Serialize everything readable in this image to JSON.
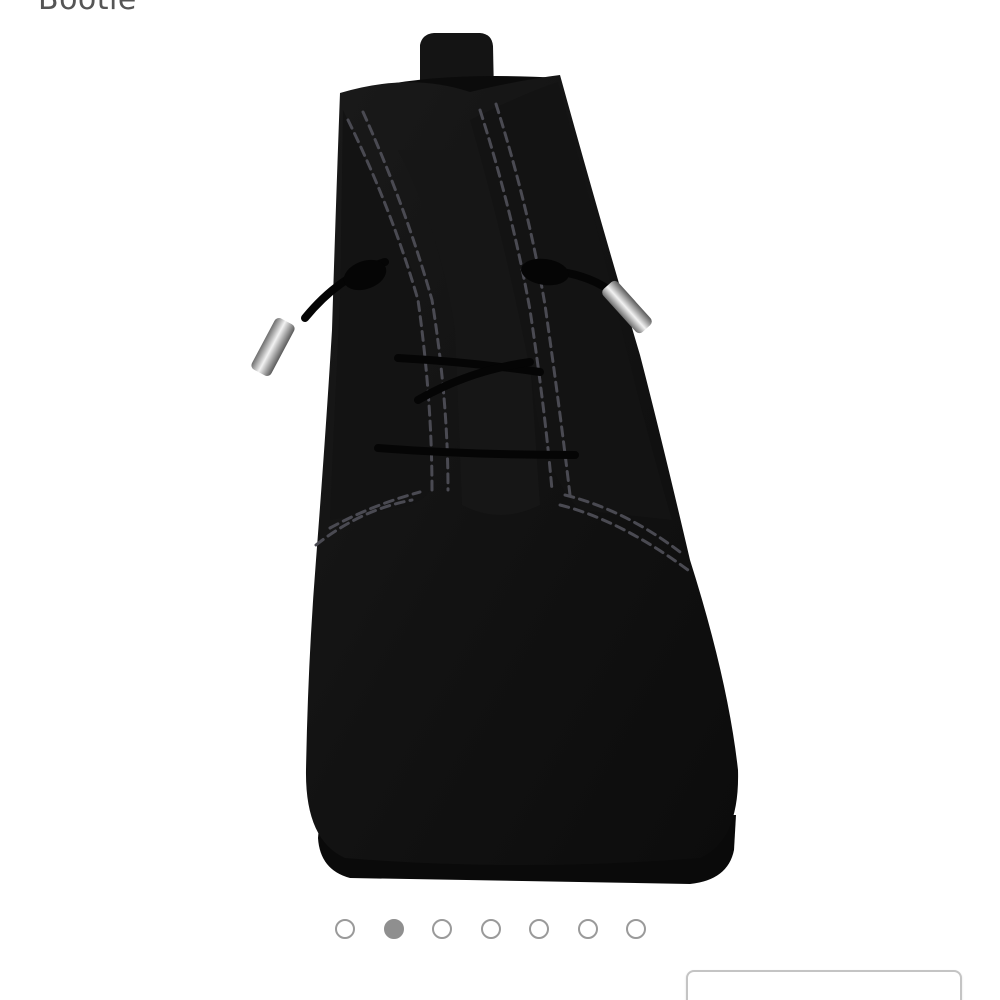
{
  "product": {
    "title": "Bootie"
  },
  "carousel": {
    "dot_count": 7,
    "active_index": 1
  },
  "colors": {
    "dot_border": "#9a9a9a",
    "dot_active": "#8f8f8f",
    "title_text": "#555555",
    "boot": "#111111"
  }
}
